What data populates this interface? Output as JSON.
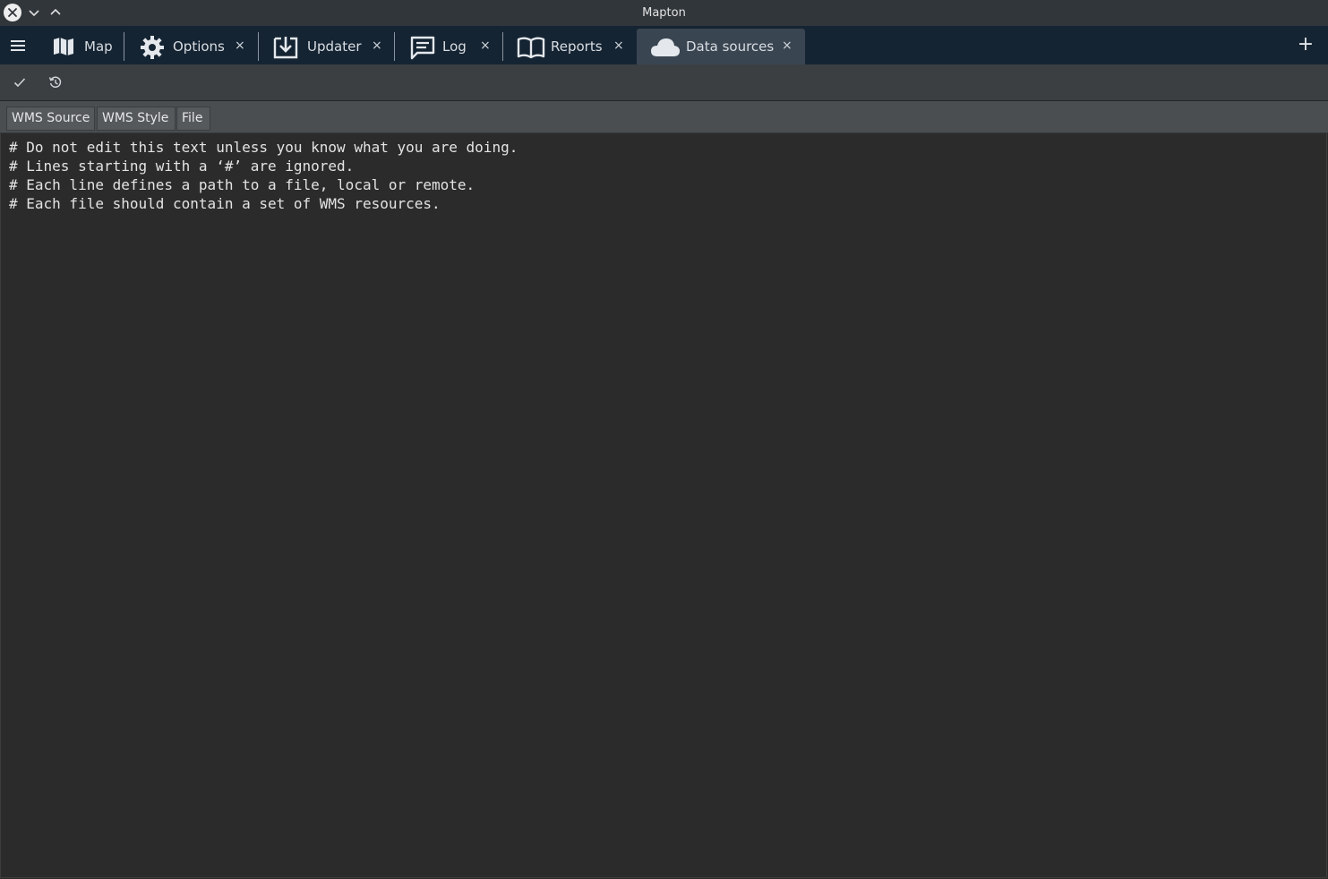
{
  "window": {
    "title": "Mapton"
  },
  "tabs": [
    {
      "label": "Map",
      "icon": "map-icon",
      "closable": false,
      "active": false
    },
    {
      "label": "Options",
      "icon": "gear-icon",
      "closable": true,
      "active": false
    },
    {
      "label": "Updater",
      "icon": "download-icon",
      "closable": true,
      "active": false
    },
    {
      "label": "Log",
      "icon": "chat-icon",
      "closable": true,
      "active": false
    },
    {
      "label": "Reports",
      "icon": "book-icon",
      "closable": true,
      "active": false
    },
    {
      "label": "Data sources",
      "icon": "cloud-icon",
      "closable": true,
      "active": true
    }
  ],
  "tab_close_glyph": "×",
  "add_glyph": "+",
  "toolbar": {
    "apply_icon": "checkmark-icon",
    "restore_icon": "restore-icon"
  },
  "subtabs": [
    "WMS Source",
    "WMS Style",
    "File"
  ],
  "editor": {
    "lines": [
      "# Do not edit this text unless you know what you are doing.",
      "# Lines starting with a ‘#’ are ignored.",
      "# Each line defines a path to a file, local or remote.",
      "# Each file should contain a set of WMS resources."
    ]
  },
  "colors": {
    "tabbar_bg": "#152433",
    "active_tab_bg": "#3a4552",
    "editor_bg": "#2b2b2b",
    "text": "#e3e3e3"
  }
}
